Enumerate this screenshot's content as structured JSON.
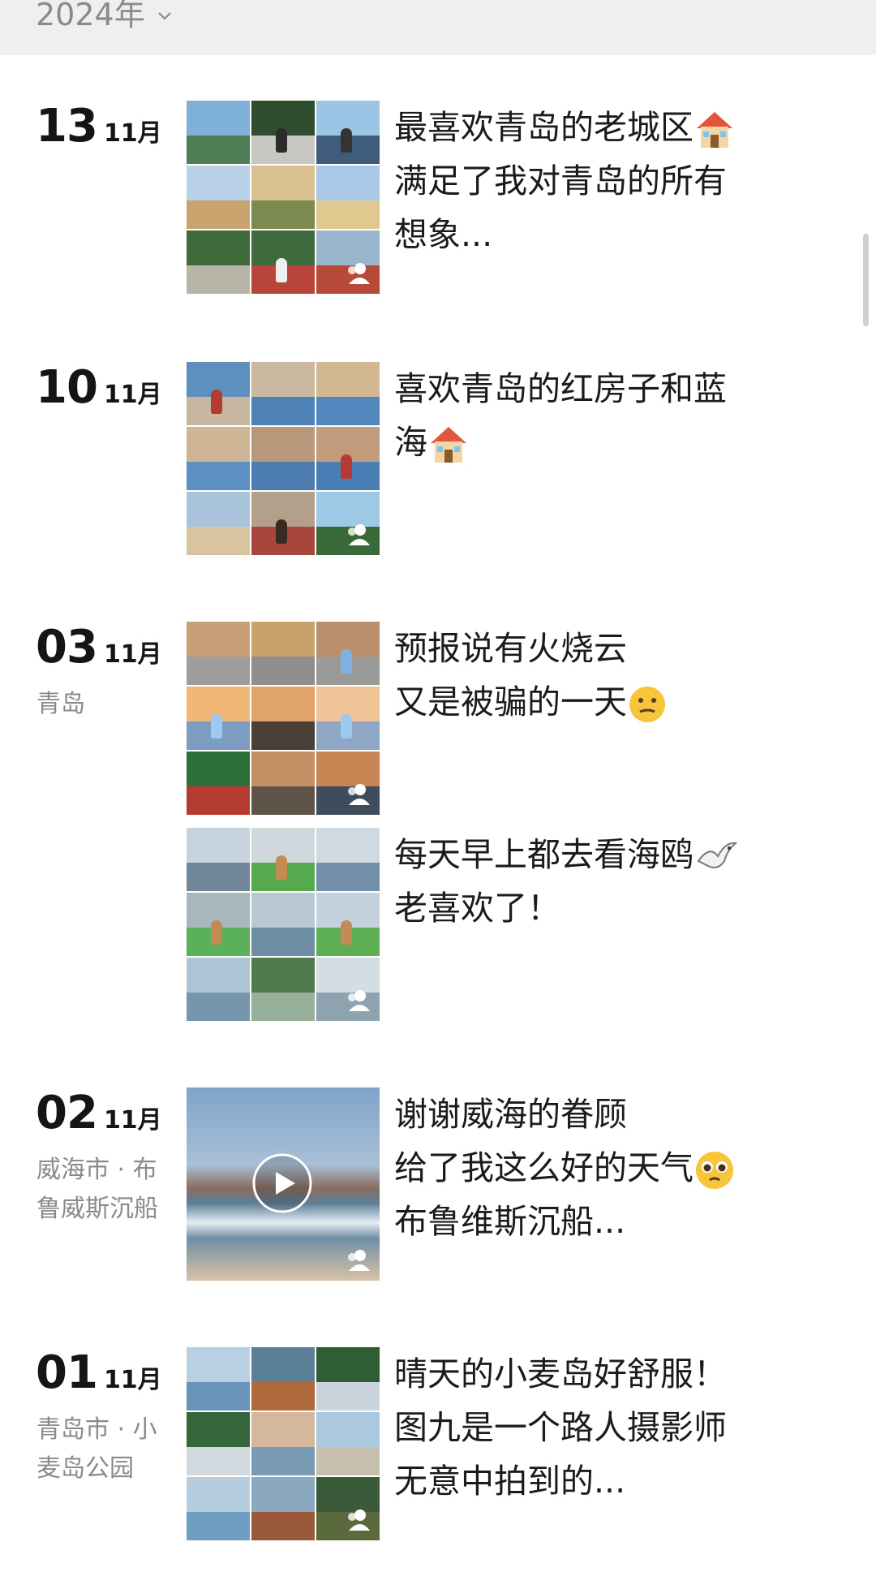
{
  "header": {
    "year_label": "2024年"
  },
  "entries": [
    {
      "day": "13",
      "month": "11月",
      "location": "",
      "caption": "最喜欢青岛的老城区",
      "caption_rest": "满足了我对青岛的所有\n想象...",
      "emoji": "house-emoji",
      "media": "grid"
    },
    {
      "day": "10",
      "month": "11月",
      "location": "",
      "caption": "喜欢青岛的红房子和蓝\n海",
      "emoji": "house-emoji",
      "media": "grid"
    },
    {
      "day": "03",
      "month": "11月",
      "location": "青岛",
      "caption": "预报说有火烧云\n又是被骗的一天",
      "emoji": "confused-face-emoji",
      "media": "grid"
    },
    {
      "day": "",
      "month": "",
      "location": "",
      "caption": "每天早上都去看海鸥",
      "caption_rest": "老喜欢了！",
      "emoji": "seagull-emoji",
      "media": "grid"
    },
    {
      "day": "02",
      "month": "11月",
      "location": "威海市 · 布鲁威斯沉船",
      "caption": "谢谢威海的眷顾\n给了我这么好的天气",
      "caption_rest": "布鲁维斯沉船...",
      "emoji": "pleading-face-emoji",
      "media": "video"
    },
    {
      "day": "01",
      "month": "11月",
      "location": "青岛市 · 小麦岛公园",
      "caption": "晴天的小麦岛好舒服！\n图九是一个路人摄影师\n无意中拍到的...",
      "media": "grid"
    }
  ],
  "colors": {
    "header_bg": "#efefef",
    "muted_text": "#8a8a8a",
    "main_text": "#1b1b1b"
  }
}
